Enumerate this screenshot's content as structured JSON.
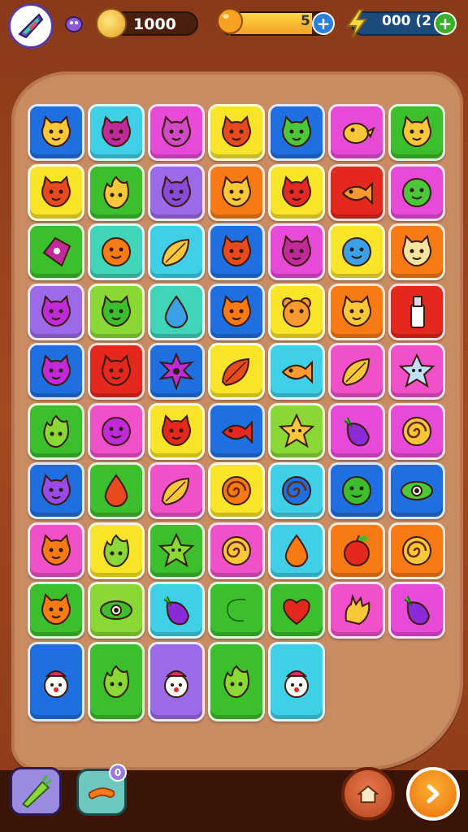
{
  "hud": {
    "coins": "1000",
    "energy": "5",
    "energy_level": 0.82,
    "gems": "000 (2",
    "avatar_icon": "crystal-shard-icon",
    "small_icon": "purple-creature-icon"
  },
  "colors": {
    "blue": "#1f6fe0",
    "cyan": "#3fd0e8",
    "magenta": "#e84ad8",
    "yellow": "#f8e428",
    "green": "#3cbf2c",
    "orange": "#f87a14",
    "red": "#e4281e",
    "purple": "#9a6ae8",
    "pink": "#f050c8",
    "lime": "#8ad836",
    "teal": "#40d4b8"
  },
  "board": {
    "rows": [
      [
        [
          "blue",
          "cat",
          "#f8c838"
        ],
        [
          "cyan",
          "cat",
          "#c02a9a"
        ],
        [
          "magenta",
          "cat",
          "#d04ac8"
        ],
        [
          "yellow",
          "cat",
          "#e84a20"
        ],
        [
          "blue",
          "cat",
          "#4ac83a"
        ],
        [
          "magenta",
          "bird",
          "#f8c838"
        ],
        [
          "green",
          "cat",
          "#f8c838"
        ]
      ],
      [
        [
          "yellow",
          "cat",
          "#e84a20"
        ],
        [
          "green",
          "flame",
          "#f8c838"
        ],
        [
          "purple",
          "cat",
          "#8a4ad8"
        ],
        [
          "orange",
          "cat",
          "#f8c838"
        ],
        [
          "yellow",
          "cat",
          "#e42828"
        ],
        [
          "red",
          "fish",
          "#f89a30"
        ],
        [
          "magenta",
          "blob",
          "#4ac83a"
        ]
      ],
      [
        [
          "green",
          "diamond",
          "#c02a9a"
        ],
        [
          "teal",
          "blob",
          "#f87a14"
        ],
        [
          "cyan",
          "leaf",
          "#f8c838"
        ],
        [
          "blue",
          "cat",
          "#e84a20"
        ],
        [
          "magenta",
          "cat",
          "#c02a9a"
        ],
        [
          "yellow",
          "blob",
          "#3aa0e8"
        ],
        [
          "orange",
          "cat",
          "#f8e4a0"
        ]
      ],
      [
        [
          "purple",
          "cat",
          "#c02ad8"
        ],
        [
          "lime",
          "cat",
          "#3cbf2c"
        ],
        [
          "teal",
          "drop",
          "#3aa0e8"
        ],
        [
          "blue",
          "cat",
          "#f87a14"
        ],
        [
          "yellow",
          "bear",
          "#f89a30"
        ],
        [
          "orange",
          "cat",
          "#f8c838"
        ],
        [
          "red",
          "bottle",
          "#ffffff"
        ]
      ],
      [
        [
          "blue",
          "cat",
          "#c02ad8"
        ],
        [
          "red",
          "cat",
          "#e4281e"
        ],
        [
          "blue",
          "spiky",
          "#c02ad8"
        ],
        [
          "yellow",
          "leaf",
          "#e84a20"
        ],
        [
          "cyan",
          "fish",
          "#f89a30"
        ],
        [
          "pink",
          "leaf",
          "#f8c838"
        ],
        [
          "pink",
          "star",
          "#bfe0f8"
        ]
      ],
      [
        [
          "green",
          "flame",
          "#8ad836"
        ],
        [
          "pink",
          "blob",
          "#c02ad8"
        ],
        [
          "yellow",
          "cat",
          "#e4281e"
        ],
        [
          "blue",
          "fish",
          "#e4281e"
        ],
        [
          "lime",
          "star",
          "#f8c838"
        ],
        [
          "magenta",
          "eggplant",
          "#8a2ad8"
        ],
        [
          "magenta",
          "swirl",
          "#f8c838"
        ]
      ],
      [
        [
          "blue",
          "cat",
          "#9a4ae8"
        ],
        [
          "green",
          "drop",
          "#e84a20"
        ],
        [
          "pink",
          "leaf",
          "#f8c838"
        ],
        [
          "yellow",
          "swirl",
          "#f87a14"
        ],
        [
          "cyan",
          "swirl",
          "#1f6fe0"
        ],
        [
          "blue",
          "blob",
          "#3cbf2c"
        ],
        [
          "blue",
          "eye",
          "#4ac83a"
        ]
      ],
      [
        [
          "pink",
          "cat",
          "#f87a14"
        ],
        [
          "yellow",
          "flame",
          "#8ad836"
        ],
        [
          "green",
          "star",
          "#8ad836"
        ],
        [
          "pink",
          "swirl",
          "#f8c838"
        ],
        [
          "cyan",
          "drop",
          "#f87a14"
        ],
        [
          "orange",
          "apple",
          "#e4281e"
        ],
        [
          "orange",
          "swirl",
          "#f8c838"
        ]
      ],
      [
        [
          "green",
          "cat",
          "#f87a14"
        ],
        [
          "lime",
          "eye",
          "#3cbf2c"
        ],
        [
          "cyan",
          "eggplant",
          "#8a2ad8"
        ],
        [
          "green",
          "snake",
          "#3cbf2c"
        ],
        [
          "green",
          "heart",
          "#e4281e"
        ],
        [
          "pink",
          "hand",
          "#f8c838"
        ],
        [
          "magenta",
          "eggplant",
          "#8a2ad8"
        ]
      ],
      [
        [
          "blue",
          "clown",
          "#ffffff"
        ],
        [
          "green",
          "flame",
          "#8ad836"
        ],
        [
          "purple",
          "clown",
          "#ffffff"
        ],
        [
          "green",
          "flame",
          "#8ad836"
        ],
        [
          "cyan",
          "clown",
          "#ffffff"
        ]
      ]
    ]
  },
  "bottom": {
    "booster1_icon": "green-carrot-icon",
    "booster2_icon": "orange-sausage-icon",
    "booster2_count": "0",
    "home_icon": "house-icon",
    "next_icon": "chevron-right-icon"
  }
}
